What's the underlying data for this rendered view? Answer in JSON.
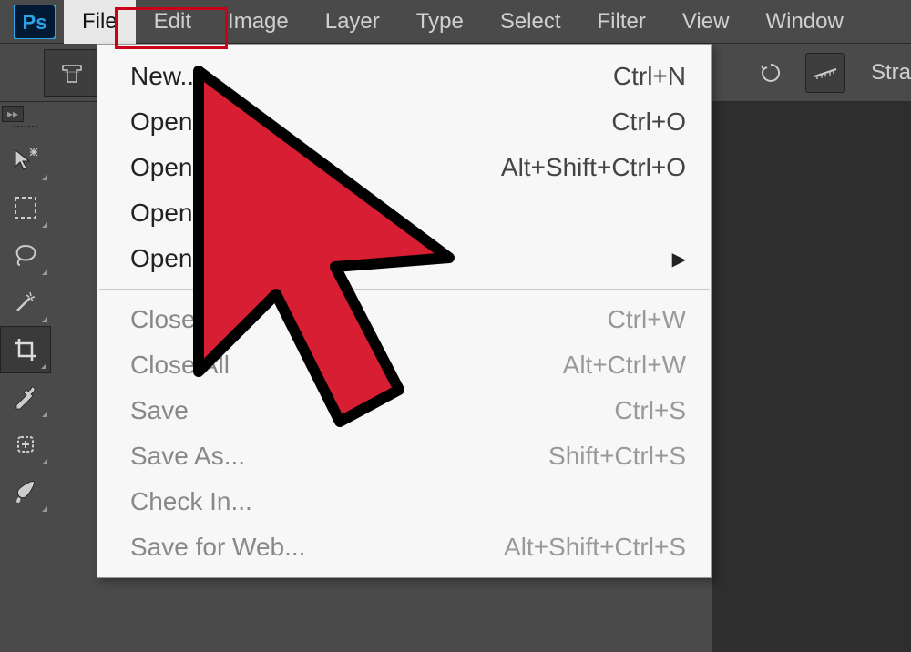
{
  "app": {
    "logo_letters": "Ps"
  },
  "menubar": {
    "items": [
      {
        "label": "File",
        "active": true
      },
      {
        "label": "Edit"
      },
      {
        "label": "Image"
      },
      {
        "label": "Layer"
      },
      {
        "label": "Type"
      },
      {
        "label": "Select"
      },
      {
        "label": "Filter"
      },
      {
        "label": "View"
      },
      {
        "label": "Window"
      }
    ]
  },
  "optionsbar": {
    "label_right": "Stra"
  },
  "dropdown": {
    "groups": [
      [
        {
          "label": "New...",
          "shortcut": "Ctrl+N",
          "enabled": true,
          "highlighted": true
        },
        {
          "label": "Open",
          "shortcut": "Ctrl+O",
          "enabled": true
        },
        {
          "label": "Open",
          "shortcut": "Alt+Shift+Ctrl+O",
          "enabled": true
        },
        {
          "label": "Open a",
          "shortcut": "",
          "enabled": true
        },
        {
          "label": "Open R",
          "shortcut": "",
          "enabled": true,
          "submenu": true
        }
      ],
      [
        {
          "label": "Close",
          "shortcut": "Ctrl+W",
          "enabled": false
        },
        {
          "label": "Close All",
          "shortcut": "Alt+Ctrl+W",
          "enabled": false
        },
        {
          "label": "Save",
          "shortcut": "Ctrl+S",
          "enabled": false
        },
        {
          "label": "Save As...",
          "shortcut": "Shift+Ctrl+S",
          "enabled": false
        },
        {
          "label": "Check In...",
          "shortcut": "",
          "enabled": false
        },
        {
          "label": "Save for Web...",
          "shortcut": "Alt+Shift+Ctrl+S",
          "enabled": false
        }
      ]
    ]
  },
  "tools": [
    {
      "name": "move-tool"
    },
    {
      "name": "marquee-tool"
    },
    {
      "name": "lasso-tool"
    },
    {
      "name": "magic-wand-tool"
    },
    {
      "name": "crop-tool",
      "selected": true
    },
    {
      "name": "eyedropper-tool"
    },
    {
      "name": "healing-brush-tool"
    },
    {
      "name": "brush-tool"
    }
  ],
  "colors": {
    "cursor_fill": "#d81e32",
    "highlight_border": "#cc0018"
  }
}
